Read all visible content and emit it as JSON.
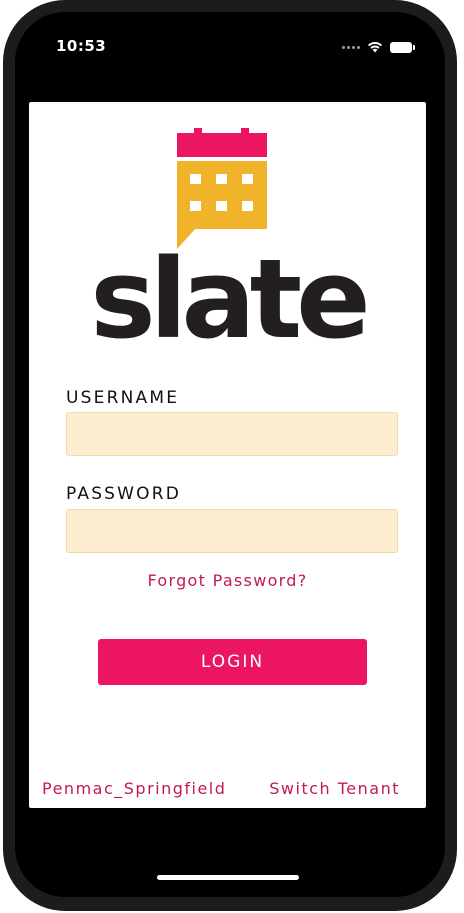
{
  "status_bar": {
    "time": "10:53",
    "icons": [
      "cellular-signal-icon",
      "wifi-icon",
      "battery-icon"
    ]
  },
  "brand": {
    "name": "slate",
    "icon": "calendar-speech-bubble-logo",
    "colors": {
      "calendar_top": "#ec1561",
      "calendar_body": "#f0b32a",
      "wordmark": "#231f20"
    }
  },
  "login_form": {
    "username_label": "USERNAME",
    "username_value": "",
    "password_label": "PASSWORD",
    "password_value": "",
    "forgot_password": "Forgot Password?",
    "login_button": "LOGIN"
  },
  "footer": {
    "tenant_name": "Penmac_Springfield",
    "switch_tenant": "Switch Tenant"
  },
  "theme": {
    "accent": "#ec1561",
    "link": "#c2185b",
    "input_background": "#fdedd0"
  }
}
